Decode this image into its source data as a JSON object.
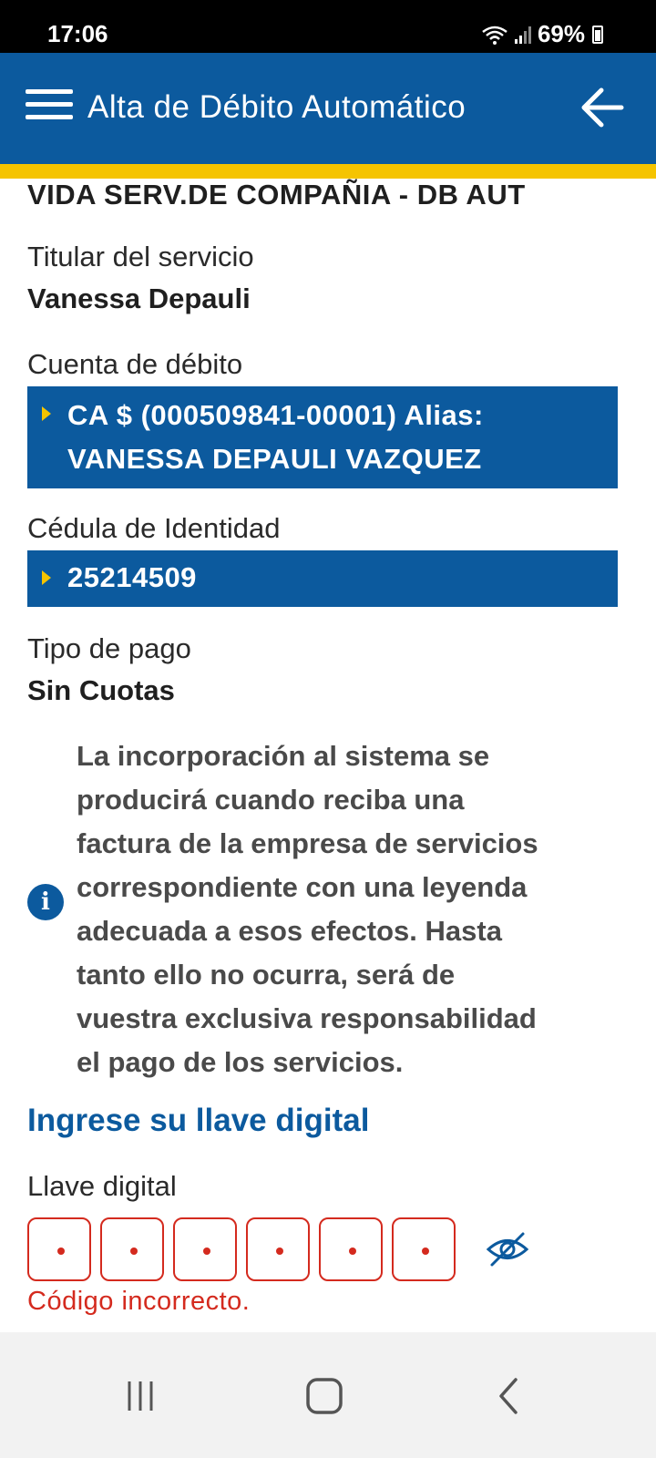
{
  "status_bar": {
    "time": "17:06",
    "battery": "69%"
  },
  "header": {
    "title": "Alta de Débito Automático"
  },
  "service": {
    "name": "VIDA SERV.DE COMPAÑIA - DB AUT"
  },
  "holder": {
    "label": "Titular del servicio",
    "value": "Vanessa Depauli"
  },
  "account": {
    "label": "Cuenta de débito",
    "line1": "CA $ (000509841-00001) Alias:",
    "line2": "VANESSA DEPAULI VAZQUEZ"
  },
  "id_card": {
    "label": "Cédula de Identidad",
    "value": "25214509"
  },
  "payment_type": {
    "label": "Tipo de pago",
    "value": "Sin Cuotas"
  },
  "info": {
    "lines": [
      "La incorporación al sistema se",
      "producirá cuando reciba una",
      "factura de la empresa de servicios",
      "correspondiente con una leyenda",
      "adecuada a esos efectos. Hasta",
      "tanto ello no ocurra, será de",
      "vuestra exclusiva responsabilidad",
      "el pago de los servicios."
    ]
  },
  "digital_key": {
    "section_title": "Ingrese su llave digital",
    "label": "Llave digital",
    "digits": [
      "•",
      "•",
      "•",
      "•",
      "•",
      "•"
    ],
    "error": "Código incorrecto."
  },
  "icons": {
    "menu": "menu-icon",
    "back": "arrow-left-icon",
    "info": "info-icon",
    "eye": "eye-off-icon",
    "wifi": "wifi-icon",
    "signal": "signal-icon",
    "battery": "battery-icon"
  },
  "colors": {
    "primary": "#0c5a9e",
    "accent": "#f5c400",
    "error": "#d42a1e"
  }
}
